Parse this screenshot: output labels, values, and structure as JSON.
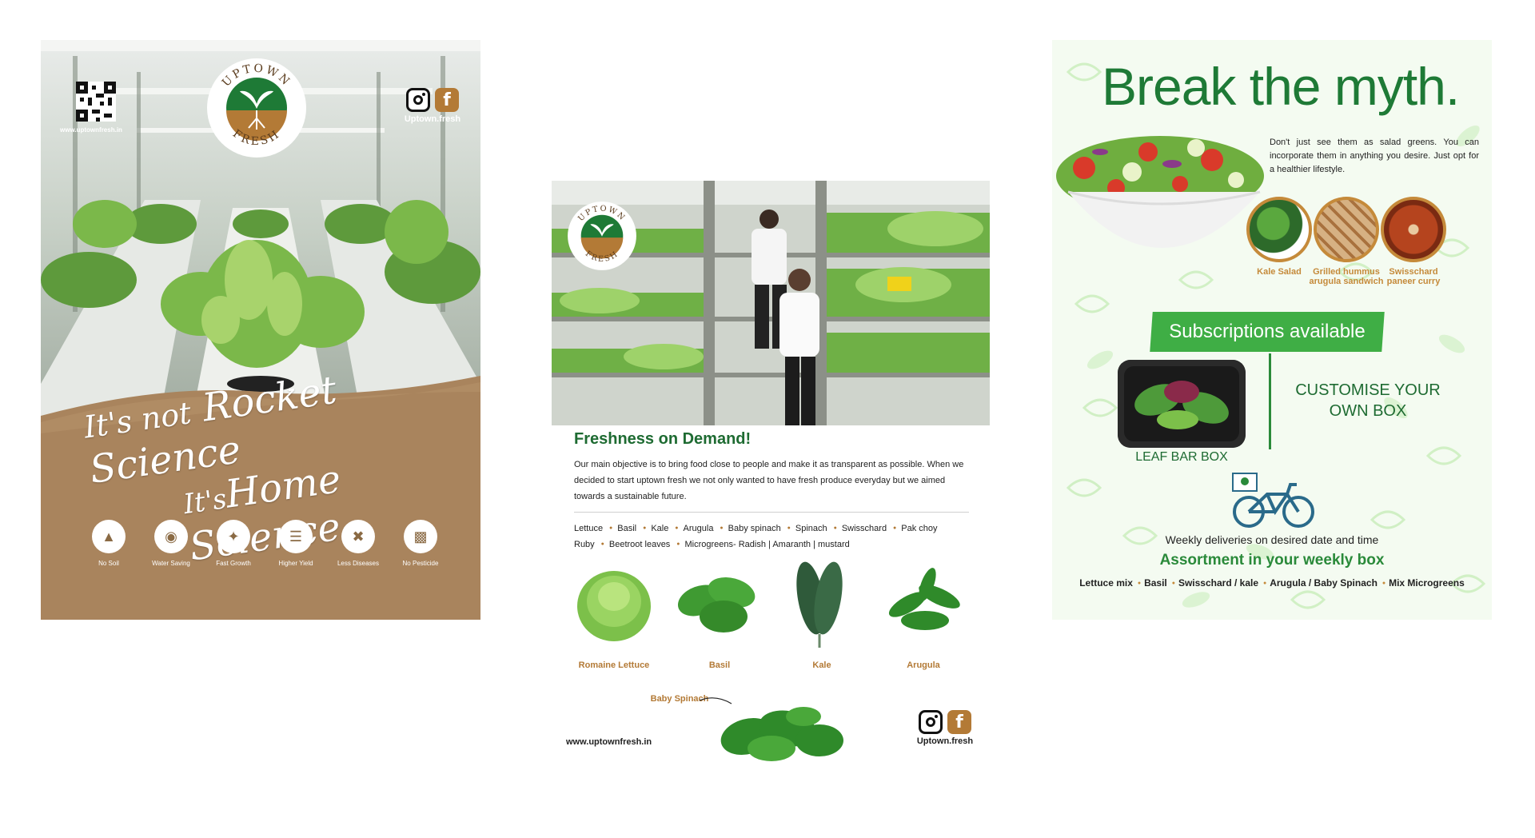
{
  "panel1": {
    "website": "www.uptownfresh.in",
    "logo_text": {
      "top": "UPTOWN",
      "bottom": "FRESH"
    },
    "social_handle": "Uptown.fresh",
    "headline": {
      "line1_small": "It's not",
      "line1_big": "Rocket Science",
      "line2_small": "It's",
      "line2_big": "Home Science"
    },
    "features": [
      {
        "icon": "no-soil-icon",
        "label": "No Soil"
      },
      {
        "icon": "water-drop-icon",
        "label": "Water Saving"
      },
      {
        "icon": "fast-growth-icon",
        "label": "Fast Growth"
      },
      {
        "icon": "higher-yield-icon",
        "label": "Higher Yield"
      },
      {
        "icon": "less-diseases-icon",
        "label": "Less Diseases"
      },
      {
        "icon": "no-pesticide-icon",
        "label": "No Pesticide"
      }
    ]
  },
  "panel2": {
    "logo_text": {
      "top": "UPTOWN",
      "bottom": "FRESH"
    },
    "title": "Freshness on Demand!",
    "paragraph": "Our main objective is to bring food close to people and make it as transparent as possible. When we decided to start uptown fresh we not only wanted to have fresh produce everyday but we aimed towards a sustainable future.",
    "produce_line1": [
      "Lettuce",
      "Basil",
      "Kale",
      "Arugula",
      "Baby spinach",
      "Spinach",
      "Swisschard",
      "Pak choy"
    ],
    "produce_line2": [
      "Ruby",
      "Beetroot leaves",
      "Microgreens- Radish | Amaranth | mustard"
    ],
    "veg_labels": {
      "romaine": "Romaine Lettuce",
      "basil": "Basil",
      "kale": "Kale",
      "arugula": "Arugula",
      "baby_spinach": "Baby Spinach"
    },
    "website": "www.uptownfresh.in",
    "social_handle": "Uptown.fresh"
  },
  "panel3": {
    "title": "Break the myth.",
    "paragraph": "Don't just see them as salad greens. You can incorporate them in anything you desire. Just opt for a healthier lifestyle.",
    "dishes": [
      {
        "name": "Kale Salad"
      },
      {
        "name": "Grilled hummus arugula sandwich"
      },
      {
        "name": "Swisschard paneer curry"
      }
    ],
    "subscriptions": "Subscriptions available",
    "box_label": "LEAF BAR BOX",
    "customise": "CUSTOMISE YOUR OWN BOX",
    "weekly": "Weekly deliveries on desired date and time",
    "assortment": "Assortment in your weekly box",
    "assortment_items": [
      "Lettuce mix",
      "Basil",
      "Swisschard / kale",
      "Arugula / Baby Spinach",
      "Mix Microgreens"
    ]
  },
  "colors": {
    "brand_green": "#1e7a36",
    "accent_brown": "#b37a36",
    "kraft": "#a9845d",
    "banner_green": "#3fae45"
  }
}
